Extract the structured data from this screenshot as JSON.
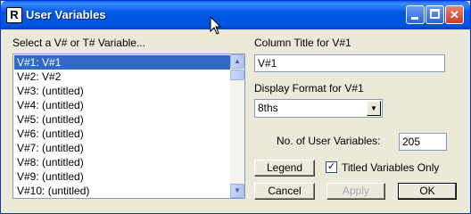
{
  "window": {
    "title": "User Variables",
    "app_icon_glyph": "R",
    "controls": [
      "minimize",
      "maximize",
      "close"
    ],
    "close_glyph": "✕"
  },
  "list": {
    "label": "Select a V# or T# Variable...",
    "items": [
      "V#1:  V#1",
      "V#2:  V#2",
      "V#3:  (untitled)",
      "V#4:  (untitled)",
      "V#5:  (untitled)",
      "V#6:  (untitled)",
      "V#7:  (untitled)",
      "V#8:  (untitled)",
      "V#9:  (untitled)",
      "V#10:  (untitled)"
    ],
    "selected_index": 0
  },
  "column_title": {
    "label": "Column Title for V#1",
    "value": "V#1"
  },
  "display_format": {
    "label": "Display Format for V#1",
    "value": "8ths"
  },
  "num_user_vars": {
    "label": "No. of User Variables:",
    "value": "205"
  },
  "buttons": {
    "legend": "Legend",
    "cancel": "Cancel",
    "apply": "Apply",
    "ok": "OK"
  },
  "titled_only": {
    "label": "Titled Variables Only",
    "checked": true,
    "glyph": "✓"
  },
  "colors": {
    "selection": "#316AC5",
    "titlebar": "#0058E6",
    "dialog_bg": "#ECE9D8"
  }
}
